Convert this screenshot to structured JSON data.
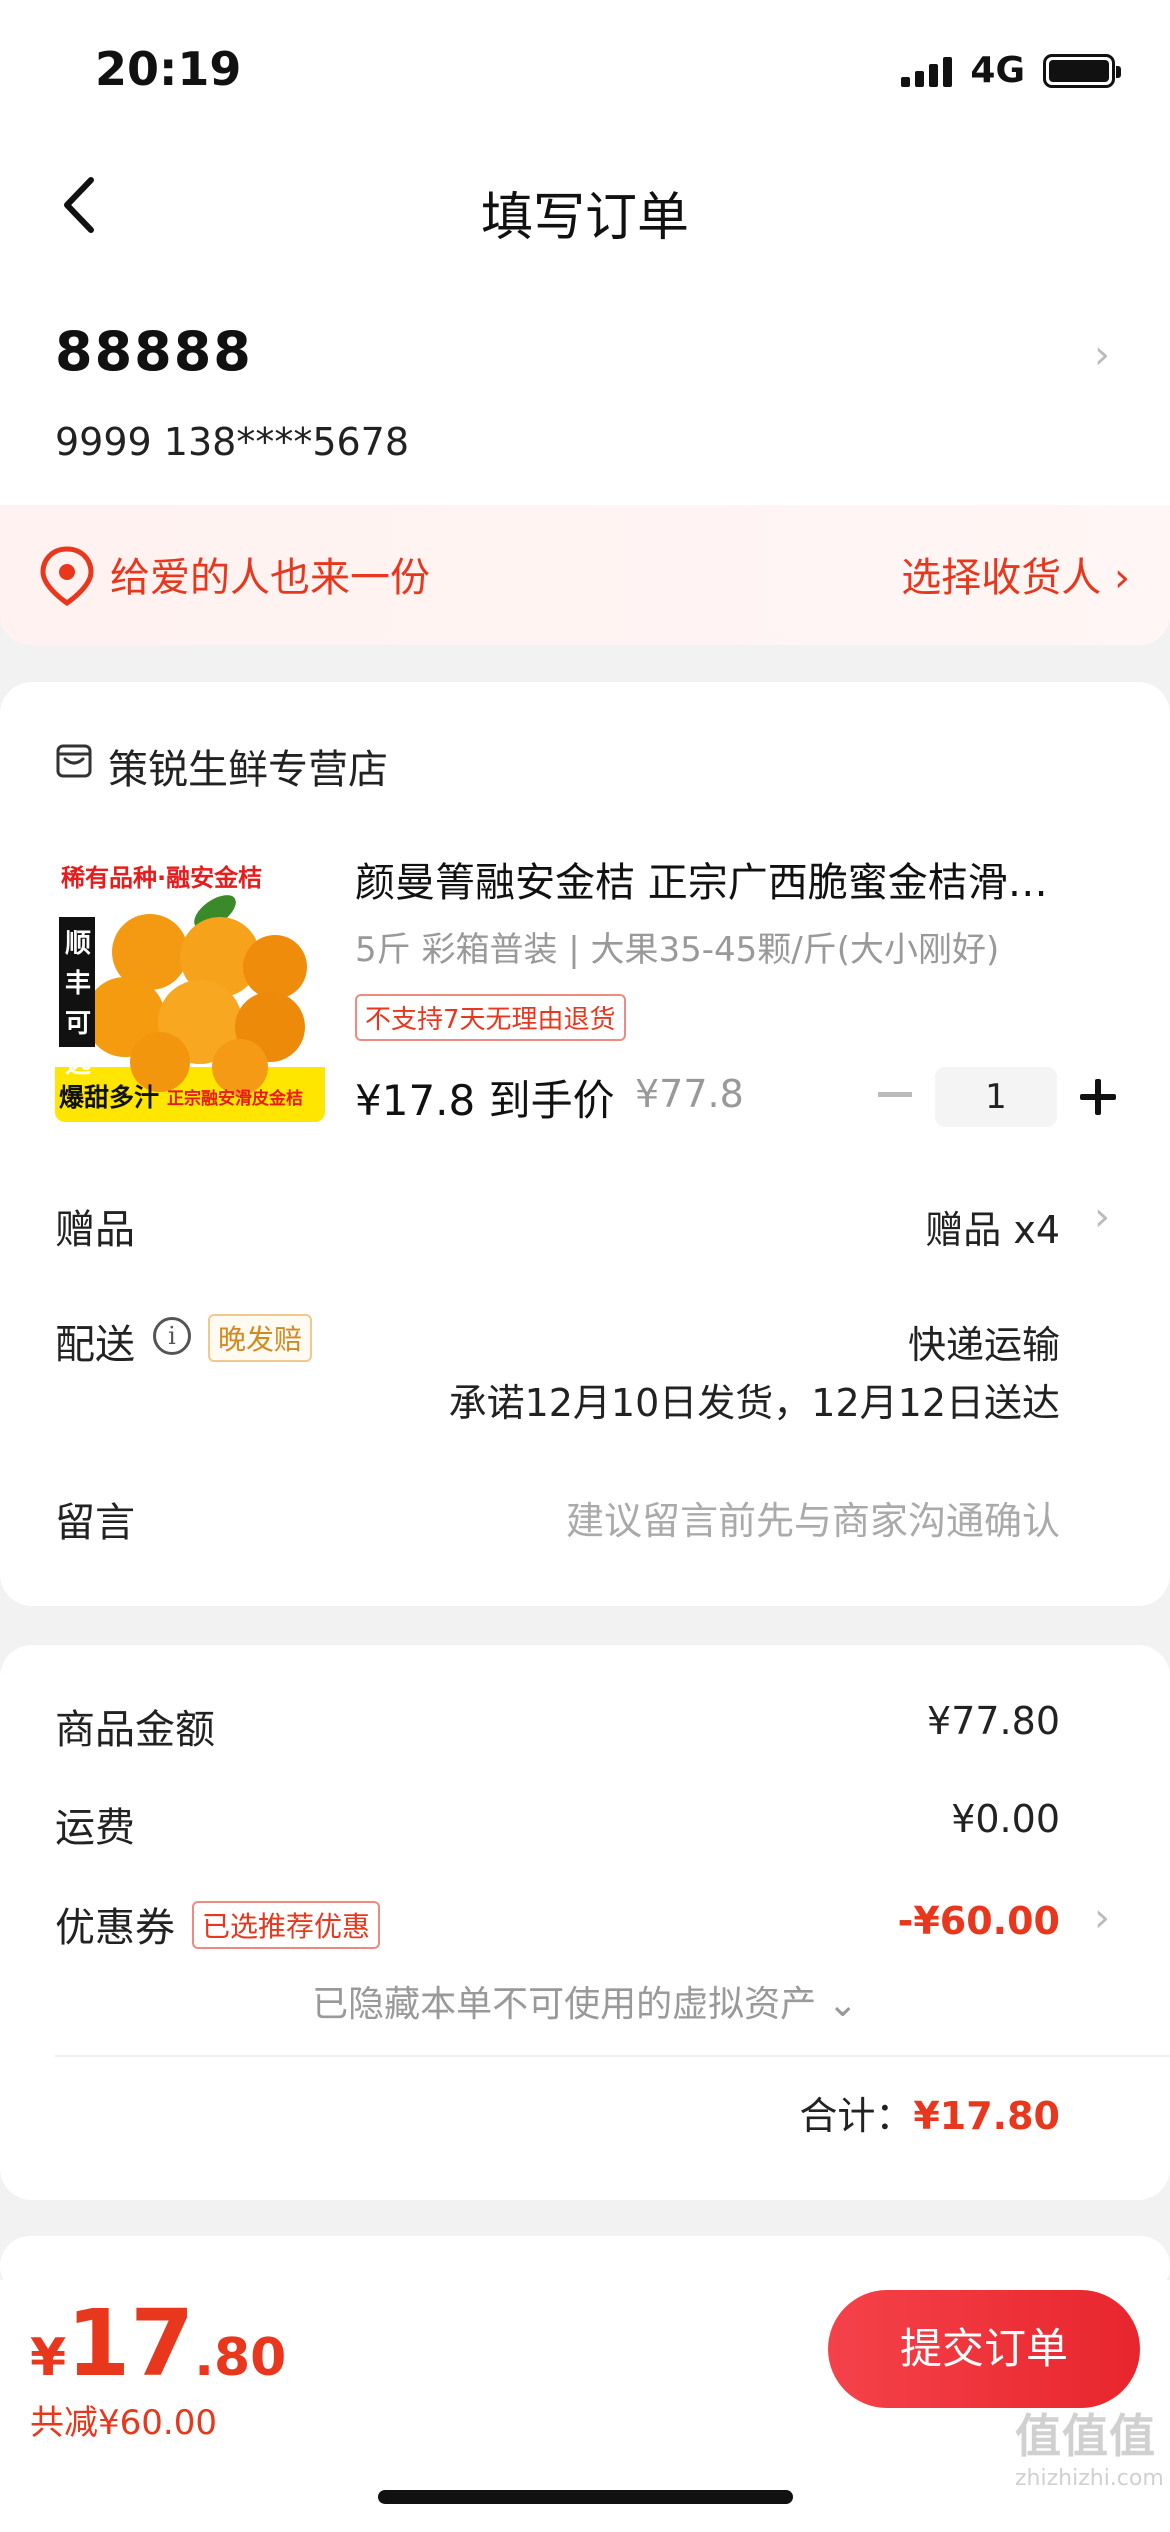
{
  "status": {
    "time": "20:19",
    "network": "4G"
  },
  "nav": {
    "title": "填写订单"
  },
  "address": {
    "name": "88888",
    "detail": "9999  138****5678"
  },
  "gift": {
    "text": "给爱的人也来一份",
    "action": "选择收货人 ›"
  },
  "shop": {
    "name": "策锐生鲜专营店"
  },
  "product": {
    "title": "颜曼箐融安金桔 正宗广西脆蜜金桔滑…",
    "spec": "5斤 彩箱普装 | 大果35-45颗/斤(大小刚好)",
    "tag": "不支持7天无理由退货",
    "price": "¥17.8 到手价",
    "original_price": "¥77.8",
    "quantity": "1",
    "image_texts": {
      "top": "稀有品种·融安金桔",
      "side": "顺丰可选",
      "bottom": "爆甜多汁",
      "bottom_small": "正宗融安滑皮金桔"
    }
  },
  "rows": {
    "gift_label": "赠品",
    "gift_value": "赠品 x4",
    "delivery_label": "配送",
    "delivery_tag": "晚发赔",
    "delivery_method": "快递运输",
    "delivery_promise": "承诺12月10日发货，12月12日送达",
    "message_label": "留言",
    "message_placeholder": "建议留言前先与商家沟通确认"
  },
  "summary": {
    "goods_label": "商品金额",
    "goods_value": "¥77.80",
    "shipping_label": "运费",
    "shipping_value": "¥0.00",
    "coupon_label": "优惠券",
    "coupon_tag": "已选推荐优惠",
    "coupon_value": "-¥60.00",
    "hidden_assets": "已隐藏本单不可使用的虚拟资产",
    "total_label": "合计：",
    "total_value": "¥17.80"
  },
  "bottom": {
    "currency": "¥",
    "price_int": "17",
    "price_dec": ".80",
    "saved": "共减¥60.00",
    "submit": "提交订单"
  },
  "watermark": {
    "big": "值值值",
    "small": "zhizhizhi.com"
  },
  "colors": {
    "accent": "#e8371d",
    "button": "#f5424a",
    "muted": "#999999"
  }
}
